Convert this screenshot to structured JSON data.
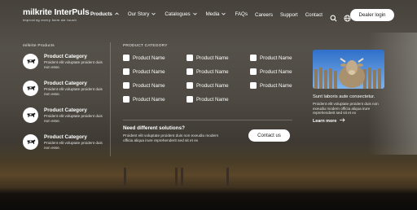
{
  "header": {
    "logo_text": "milkrite InterPuls",
    "logo_tagline": "improving every farm we touch",
    "nav_left": [
      {
        "label": "Products",
        "chevron": "chevron-up"
      },
      {
        "label": "Our Story",
        "chevron": "chevron-down"
      },
      {
        "label": "Catalogues",
        "chevron": "chevron-down"
      },
      {
        "label": "Media",
        "chevron": "chevron-down"
      },
      {
        "label": "FAQs",
        "chevron": ""
      }
    ],
    "nav_right": [
      "Careers",
      "Support",
      "Contact"
    ],
    "icons": [
      "search-icon",
      "globe-icon"
    ],
    "login_label": "Dealer login"
  },
  "menu": {
    "products_heading": "milkrite Products",
    "categories": [
      {
        "title": "Product Category",
        "desc": "Proident elit voluptate proident duis non esse.",
        "icon": "cow-icon"
      },
      {
        "title": "Product Category",
        "desc": "Proident elit voluptate proident duis non esse.",
        "icon": "cow-icon"
      },
      {
        "title": "Product Category",
        "desc": "Proident elit voluptate proident duis non esse.",
        "icon": "cow-icon"
      },
      {
        "title": "Product Category",
        "desc": "Proident elit voluptate proident duis non esse.",
        "icon": "cow-icon"
      }
    ],
    "category_heading": "PRODUCT CATEGORY",
    "product_names": [
      "Product Name",
      "Product Name",
      "Product Name",
      "Product Name",
      "Product Name",
      "Product Name",
      "Product Name",
      "Product Name",
      "Product Name",
      "Product Name",
      "Product Name"
    ],
    "need_title": "Need different solutions?",
    "need_desc": "Proident elit voluptate proident duis non exeudiu modern officia aliqua irure reprehenderit sed sit et ex",
    "contact_label": "Contact us",
    "article_title": "Sunt laboris aute consectetur.",
    "article_desc": "Proident elit voluptate proident duis non exeudiu modern officia aliqua irure reprehenderit sed sit et ex",
    "learn_label": "Learn more"
  }
}
